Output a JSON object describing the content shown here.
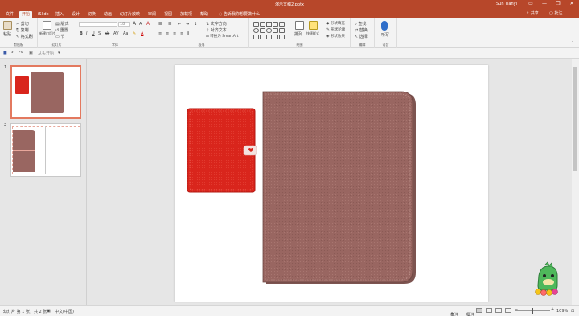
{
  "window": {
    "title": "演示文稿2.pptx",
    "user": "Sun Tianyi",
    "minimize": "—",
    "restore": "❐",
    "close": "✕"
  },
  "tabs": [
    "文件",
    "开始",
    "iSlide",
    "插入",
    "设计",
    "切换",
    "动画",
    "幻灯片放映",
    "审阅",
    "视图",
    "加载项",
    "帮助"
  ],
  "active_tab": "开始",
  "tell_me": "告诉我你想要做什么",
  "share": "共享",
  "comments": "批注",
  "ribbon": {
    "groups": [
      "剪贴板",
      "幻灯片",
      "字体",
      "段落",
      "绘图",
      "编辑",
      "语音"
    ],
    "paste": "粘贴",
    "cut": "剪切",
    "copy": "复制",
    "format_painter": "格式刷",
    "new_slide": "新建幻灯片",
    "layout": "版式",
    "reset": "重置",
    "section": "节",
    "font_size": "18",
    "text_direction": "文字方向",
    "align_text": "对齐文本",
    "convert_smartart": "转换为 SmartArt",
    "arrange": "排列",
    "quick_styles": "快速样式",
    "shape_fill": "形状填充",
    "shape_outline": "形状轮廓",
    "shape_effects": "形状效果",
    "find": "查找",
    "replace": "替换",
    "select": "选择",
    "dictate": "听写"
  },
  "qat": {
    "from_start": "从头开始"
  },
  "thumbnails": [
    {
      "number": "1",
      "selected": true
    },
    {
      "number": "2",
      "selected": false
    }
  ],
  "status": {
    "slide_info": "幻灯片 第 1 张，共 2 张",
    "language": "中文(中国)",
    "notes": "备注",
    "comments": "批注",
    "zoom": "109%"
  },
  "colors": {
    "accent": "#b7472a",
    "red_book": "#d9251c",
    "brown_notebook": "#996661",
    "thumb_selected": "#e3795f"
  }
}
